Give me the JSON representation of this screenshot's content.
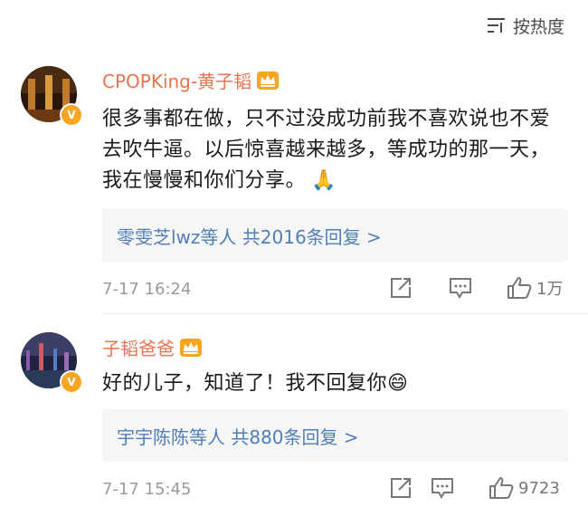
{
  "sort": {
    "label": "按热度",
    "icon": "sort-lines-icon"
  },
  "comments": [
    {
      "username": "CPOPKing-黄子韬",
      "text": "很多事都在做，只不过没成功前我不喜欢说也不爱去吹牛逼。以后惊喜越来越多，等成功的那一天，我在慢慢和你们分享。",
      "emoji": "🙏",
      "reply_summary": "零雯芝lwz等人 共2016条回复 >",
      "time": "7-17 16:24",
      "likes": "1万"
    },
    {
      "username": "子韬爸爸",
      "text": "好的儿子，知道了！我不回复你",
      "emoji": "😄",
      "reply_summary": "宇宇陈陈等人 共880条回复 >",
      "time": "7-17 15:45",
      "likes": "9723"
    }
  ],
  "colors": {
    "username": "#eb7350",
    "reply_link": "#4f7fb8",
    "meta": "#9a9a9a",
    "verified": "#f6a623"
  }
}
